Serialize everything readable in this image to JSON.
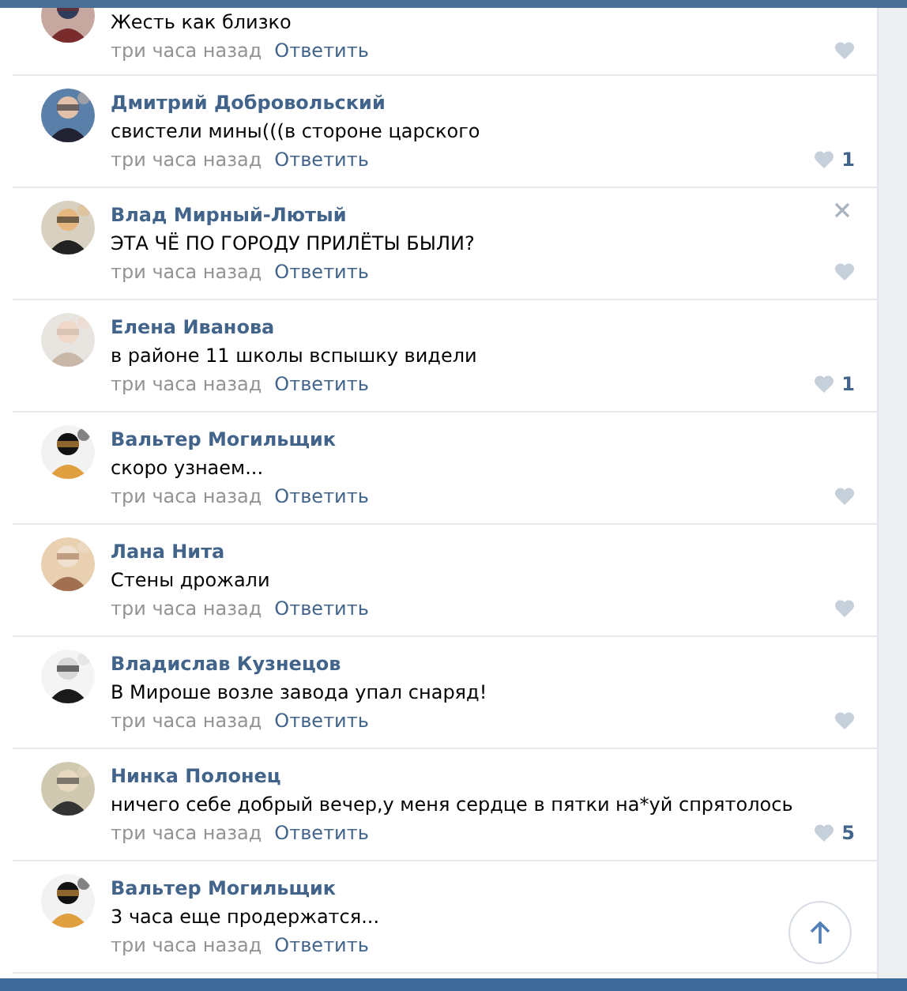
{
  "comments": [
    {
      "text": "Жесть как близко",
      "time": "три часа назад",
      "reply": "Ответить",
      "liked": false,
      "close_visible": false
    },
    {
      "name": "Дмитрий Добровольский",
      "text": "свистели мины(((в стороне царского",
      "time": "три часа назад",
      "reply": "Ответить",
      "likes": "1",
      "liked": false,
      "close_visible": false
    },
    {
      "name": "Влад Мирный-Лютый",
      "text": "ЭТА ЧЁ ПО ГОРОДУ ПРИЛЁТЫ БЫЛИ?",
      "time": "три часа назад",
      "reply": "Ответить",
      "liked": false,
      "close_visible": true
    },
    {
      "name": "Елена Иванова",
      "text": "в районе 11 школы вспышку видели",
      "time": "три часа назад",
      "reply": "Ответить",
      "likes": "1",
      "liked": false,
      "close_visible": false
    },
    {
      "name": "Вальтер Могильщик",
      "text": "скоро узнаем...",
      "time": "три часа назад",
      "reply": "Ответить",
      "liked": false,
      "close_visible": false
    },
    {
      "name": "Лана Нита",
      "text": "Стены дрожали",
      "time": "три часа назад",
      "reply": "Ответить",
      "liked": false,
      "close_visible": false
    },
    {
      "name": "Владислав Кузнецов",
      "text": "В Мироше возле завода упал снаряд!",
      "time": "три часа назад",
      "reply": "Ответить",
      "liked": false,
      "close_visible": false
    },
    {
      "name": "Нинка Полонец",
      "text": "ничего себе добрый вечер,у меня сердце в пятки на*уй спрятолось",
      "time": "три часа назад",
      "reply": "Ответить",
      "likes": "5",
      "liked": false,
      "close_visible": false
    },
    {
      "name": "Вальтер Могильщик",
      "text": "3 часа еще продержатся...",
      "time": "три часа назад",
      "reply": "Ответить",
      "close_visible": false
    }
  ]
}
